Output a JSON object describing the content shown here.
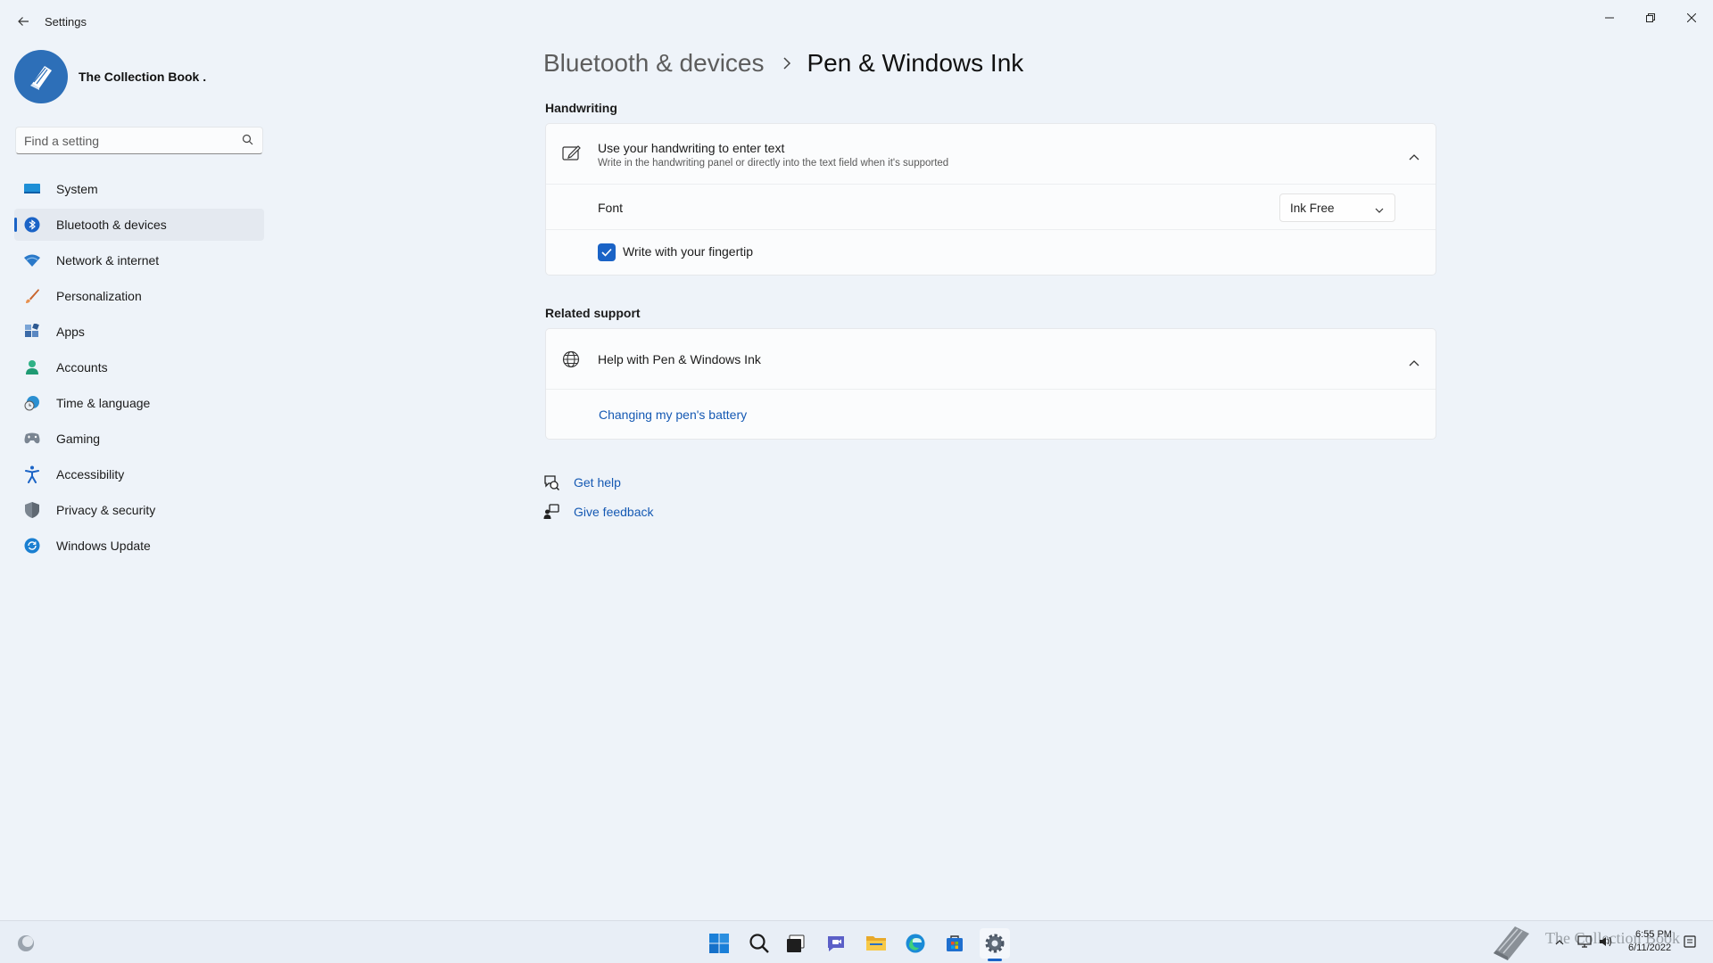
{
  "window": {
    "title": "Settings"
  },
  "profile": {
    "name": "The Collection Book ."
  },
  "search": {
    "placeholder": "Find a setting"
  },
  "sidebar": {
    "items": [
      {
        "label": "System",
        "icon": "system-icon"
      },
      {
        "label": "Bluetooth & devices",
        "icon": "bluetooth-icon",
        "active": true
      },
      {
        "label": "Network & internet",
        "icon": "wifi-icon"
      },
      {
        "label": "Personalization",
        "icon": "brush-icon"
      },
      {
        "label": "Apps",
        "icon": "apps-icon"
      },
      {
        "label": "Accounts",
        "icon": "person-icon"
      },
      {
        "label": "Time & language",
        "icon": "clock-globe-icon"
      },
      {
        "label": "Gaming",
        "icon": "gamepad-icon"
      },
      {
        "label": "Accessibility",
        "icon": "accessibility-icon"
      },
      {
        "label": "Privacy & security",
        "icon": "shield-icon"
      },
      {
        "label": "Windows Update",
        "icon": "update-icon"
      }
    ]
  },
  "breadcrumb": {
    "parent": "Bluetooth & devices",
    "current": "Pen & Windows Ink"
  },
  "handwriting": {
    "section_title": "Handwriting",
    "title": "Use your handwriting to enter text",
    "subtitle": "Write in the handwriting panel or directly into the text field when it's supported",
    "font_label": "Font",
    "font_value": "Ink Free",
    "fingertip_label": "Write with your fingertip",
    "fingertip_checked": true
  },
  "support": {
    "section_title": "Related support",
    "title": "Help with Pen & Windows Ink",
    "link": "Changing my pen's battery"
  },
  "help": {
    "get_help": "Get help",
    "give_feedback": "Give feedback"
  },
  "taskbar": {
    "time": "6:55 PM",
    "date": "6/11/2022",
    "watermark": "The Collection Book"
  },
  "colors": {
    "accent": "#1a63c6",
    "background": "#eef3f9",
    "card": "#fbfcfd"
  }
}
